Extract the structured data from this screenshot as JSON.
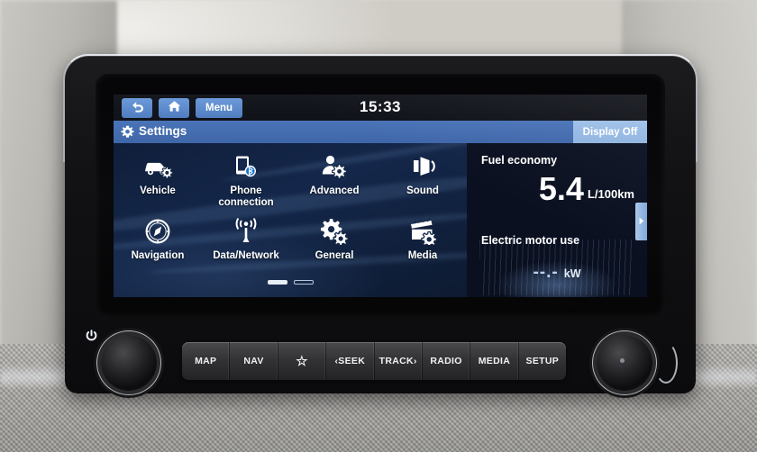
{
  "device": {
    "type": "car-infotainment-head-unit",
    "brand_screen_accent": "#4a74b8",
    "screen_background": "#12244a"
  },
  "statusbar": {
    "back_icon": "back-arrow-icon",
    "home_icon": "home-icon",
    "menu_label": "Menu",
    "clock": "15:33"
  },
  "titlebar": {
    "gear_icon": "gear-icon",
    "title": "Settings",
    "display_off_label": "Display Off"
  },
  "settings_grid": {
    "items": [
      {
        "label": "Vehicle",
        "icon": "car-gear-icon"
      },
      {
        "label": "Phone\nconnection",
        "label_line1": "Phone",
        "label_line2": "connection",
        "icon": "phone-bluetooth-icon"
      },
      {
        "label": "Advanced",
        "icon": "person-gear-icon"
      },
      {
        "label": "Sound",
        "icon": "speaker-icon"
      },
      {
        "label": "Navigation",
        "icon": "compass-icon"
      },
      {
        "label": "Data/Network",
        "icon": "antenna-signal-icon"
      },
      {
        "label": "General",
        "icon": "gears-icon"
      },
      {
        "label": "Media",
        "icon": "clapperboard-gear-icon"
      }
    ],
    "pages": {
      "total": 2,
      "current": 1
    }
  },
  "info_panel": {
    "fuel_economy_title": "Fuel economy",
    "fuel_economy_value": "5.4",
    "fuel_economy_unit": "L/100km",
    "electric_motor_title": "Electric motor use",
    "electric_motor_value": "--.-",
    "electric_motor_unit": "kW",
    "expand_tab_icon": "chevron-right-icon"
  },
  "hard_keys": [
    {
      "label": "MAP"
    },
    {
      "label": "NAV"
    },
    {
      "label": "☆",
      "name": "favorite-star"
    },
    {
      "label": "‹SEEK"
    },
    {
      "label": "TRACK›"
    },
    {
      "label": "RADIO"
    },
    {
      "label": "MEDIA"
    },
    {
      "label": "SETUP"
    }
  ],
  "knobs": {
    "left": {
      "name": "power-volume-knob",
      "icon": "power-icon"
    },
    "right": {
      "name": "tune-scroll-knob"
    }
  }
}
